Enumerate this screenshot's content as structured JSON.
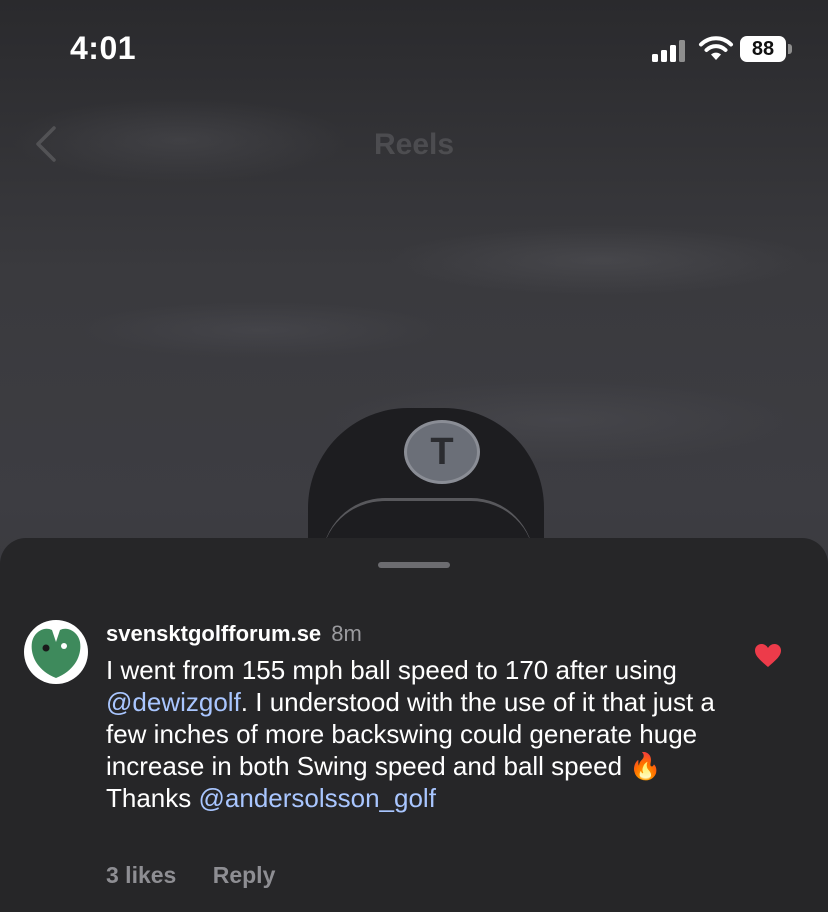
{
  "status_bar": {
    "time": "4:01",
    "battery": "88"
  },
  "nav": {
    "title": "Reels"
  },
  "background": {
    "cap_logo_letter": "T"
  },
  "comment": {
    "username": "svensktgolfforum.se",
    "time_ago": "8m",
    "text_parts": {
      "p1": "I went from 155 mph ball speed to 170 after using ",
      "mention1": "@dewizgolf",
      "p2": ". I understood with the use of it that just a few inches of more backswing could generate huge increase in both Swing speed and ball speed ",
      "emoji": "🔥",
      "p3": " Thanks ",
      "mention2": "@andersolsson_golf"
    },
    "likes": "3 likes",
    "reply_label": "Reply",
    "liked": true
  },
  "colors": {
    "like_heart": "#ed3b4a",
    "mention": "#a9c6ff",
    "sheet_bg": "#262628"
  }
}
